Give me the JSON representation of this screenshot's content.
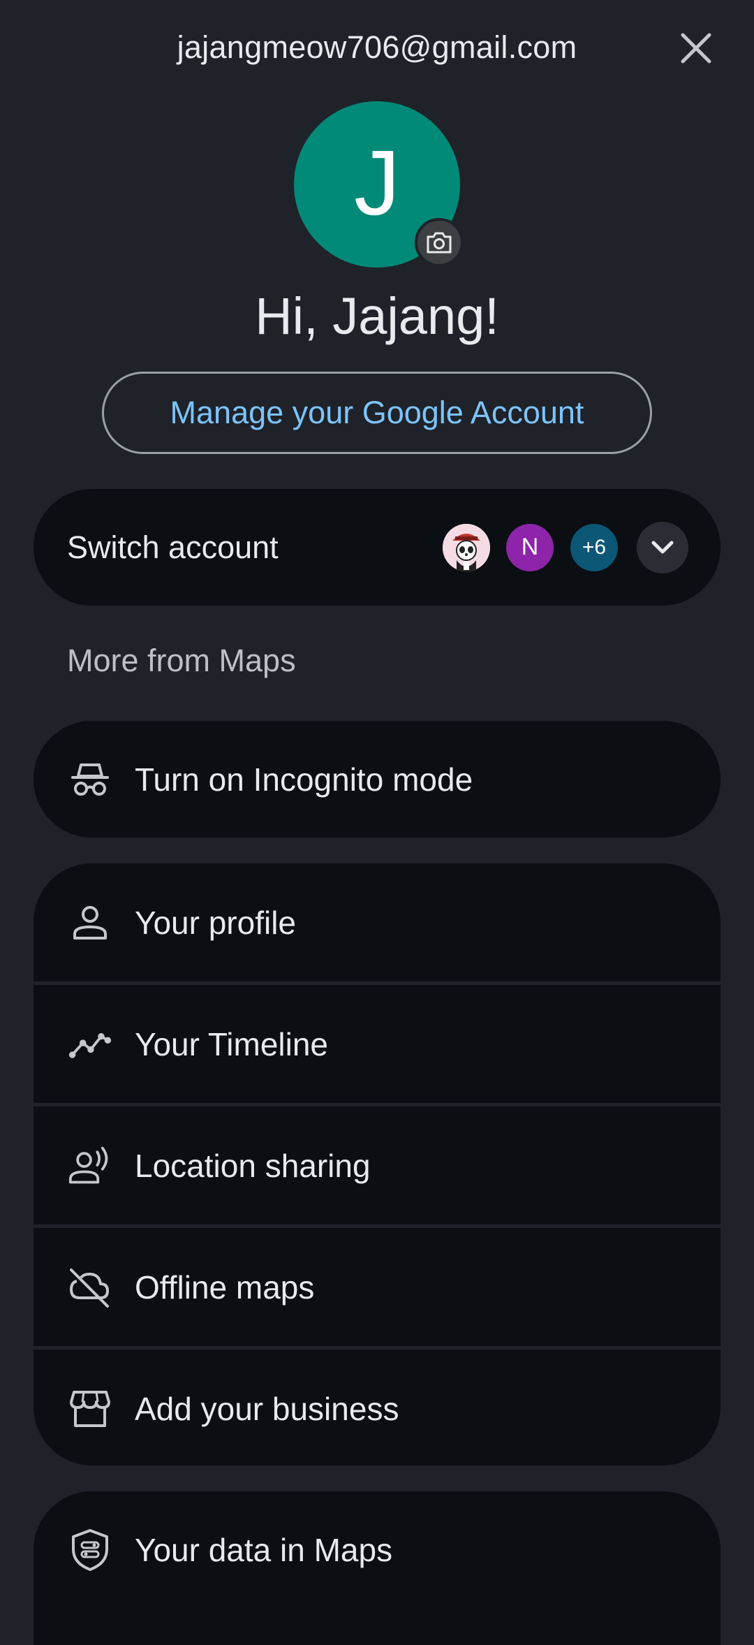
{
  "header": {
    "email": "jajangmeow706@gmail.com"
  },
  "profile": {
    "avatar_letter": "J",
    "avatar_color": "#018a77",
    "greeting": "Hi, Jajang!",
    "manage_label": "Manage your Google Account"
  },
  "switch_account": {
    "label": "Switch account",
    "accounts": [
      {
        "type": "image",
        "icon": "panda-avatar-icon"
      },
      {
        "type": "letter",
        "text": "N",
        "color": "#8e24aa"
      },
      {
        "type": "count",
        "text": "+6",
        "color": "#0c5676"
      }
    ]
  },
  "more_section": {
    "title": "More from Maps"
  },
  "incognito": {
    "label": "Turn on Incognito mode",
    "icon": "incognito-icon"
  },
  "menu_items": [
    {
      "label": "Your profile",
      "icon": "person-icon"
    },
    {
      "label": "Your Timeline",
      "icon": "timeline-icon"
    },
    {
      "label": "Location sharing",
      "icon": "location-sharing-icon"
    },
    {
      "label": "Offline maps",
      "icon": "cloud-off-icon"
    },
    {
      "label": "Add your business",
      "icon": "storefront-icon"
    }
  ],
  "data_item": {
    "label": "Your data in Maps",
    "icon": "shield-icon"
  },
  "colors": {
    "background": "#1f2229",
    "card": "#0b0e12",
    "accent_link": "#7cc4fa"
  }
}
